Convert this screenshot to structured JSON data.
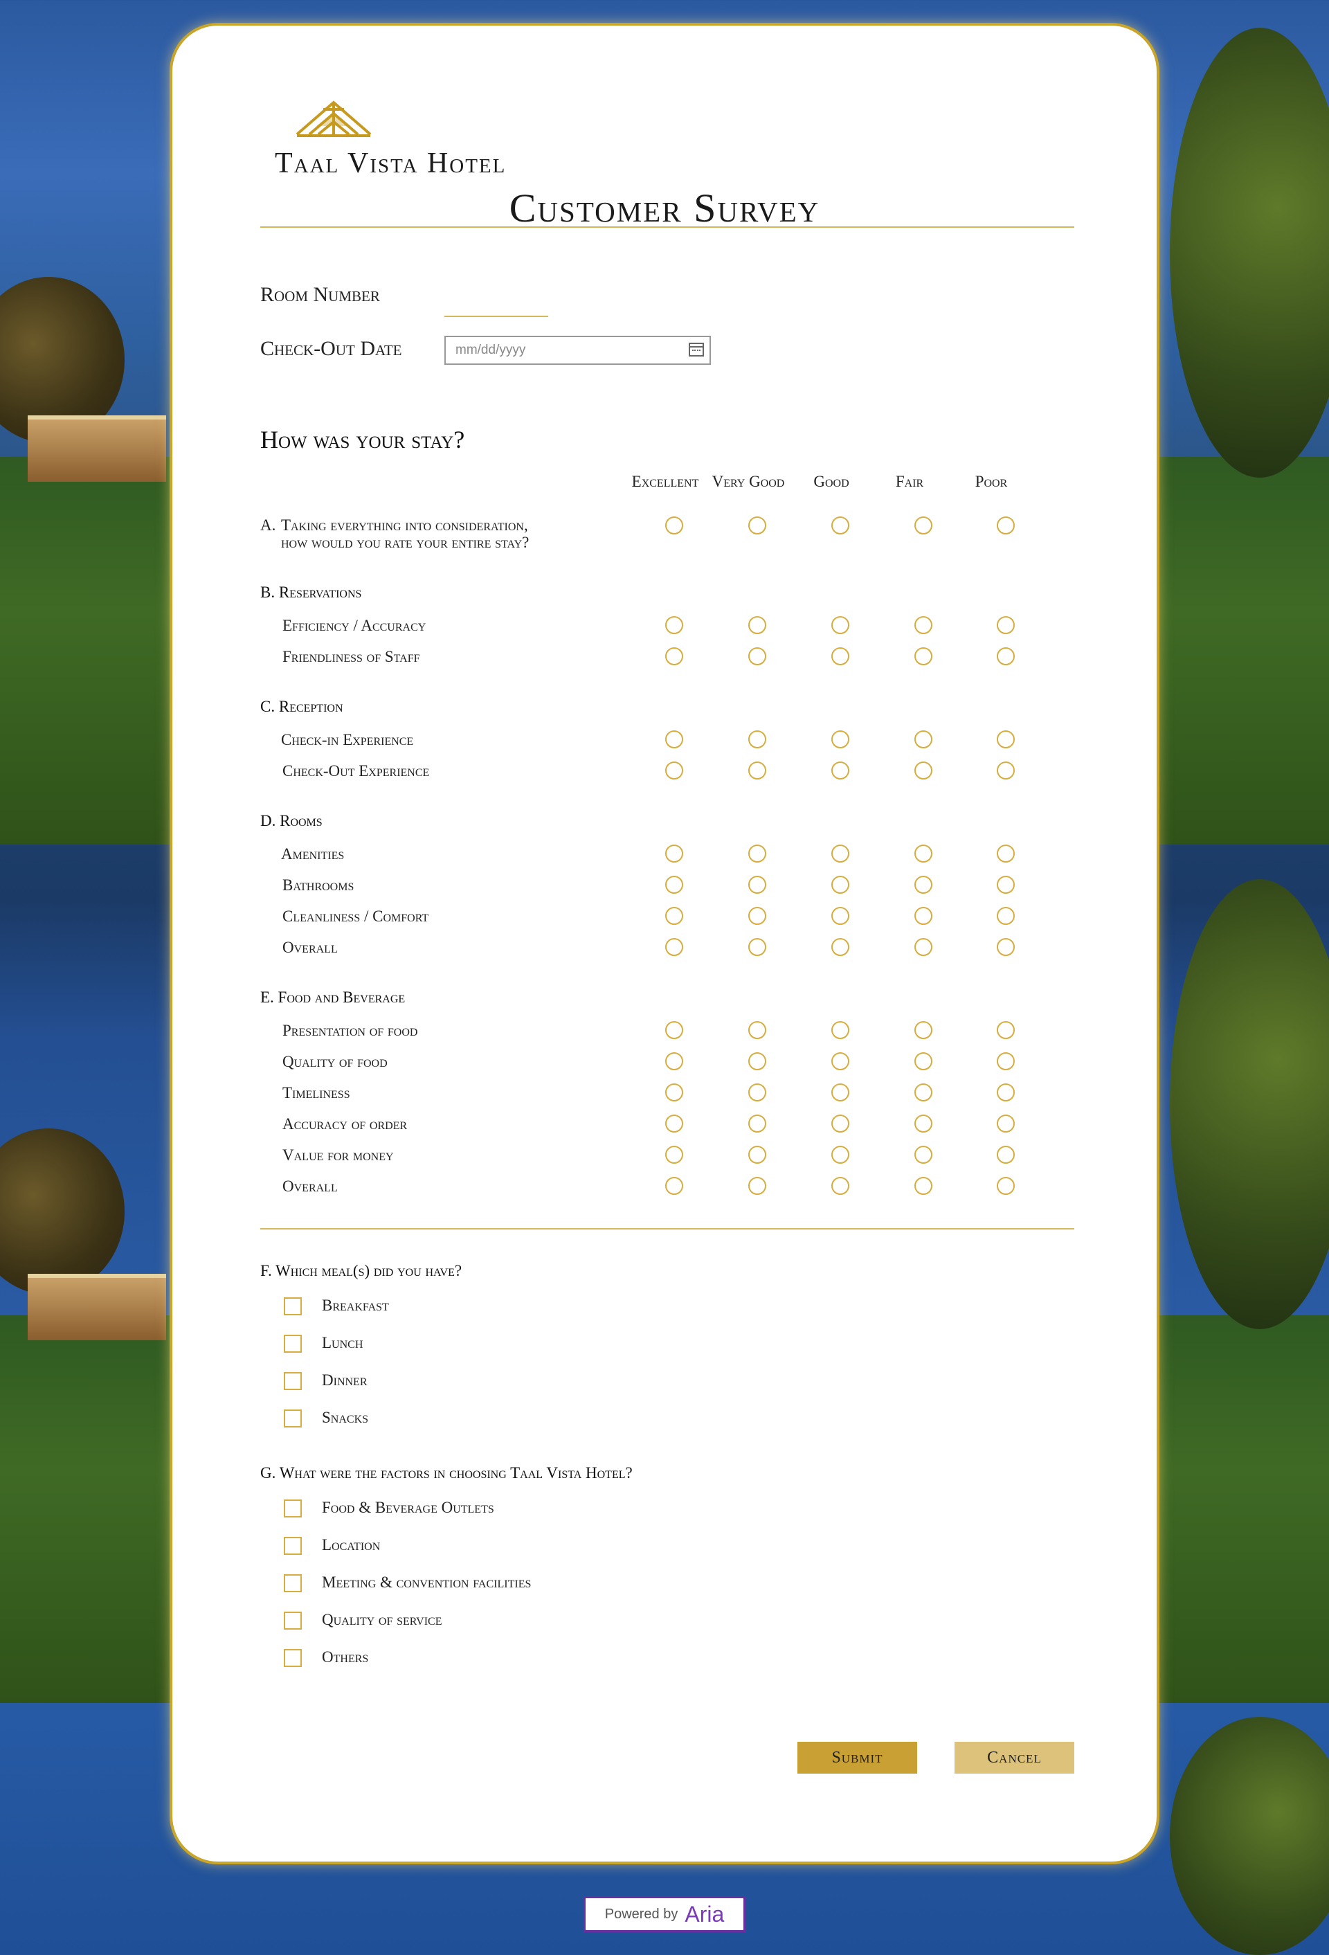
{
  "brand": {
    "name": "Taal Vista Hotel",
    "accent": "#c9a52a"
  },
  "page_title": "Customer Survey",
  "room_number": {
    "label": "Room Number",
    "value": ""
  },
  "checkout_date": {
    "label": "Check-Out Date",
    "placeholder": "mm/dd/yyyy"
  },
  "rating_section": {
    "heading": "How was your stay?",
    "columns": [
      "Excellent",
      "Very Good",
      "Good",
      "Fair",
      "Poor"
    ],
    "question_a": {
      "label": "A.",
      "line1": "Taking everything into consideration,",
      "line2": "how would you rate your entire stay?"
    },
    "groups": [
      {
        "label": "B.  Reservations",
        "items": [
          "Efficiency / Accuracy",
          "Friendliness of Staff"
        ]
      },
      {
        "label": "C.  Reception",
        "items": [
          "Check-in Experience",
          "Check-Out Experience"
        ]
      },
      {
        "label": "D.  Rooms",
        "items": [
          "Amenities",
          "Bathrooms",
          "Cleanliness / Comfort",
          "Overall"
        ]
      },
      {
        "label": "E.  Food and Beverage",
        "items": [
          "Presentation of food",
          "Quality of food",
          "Timeliness",
          "Accuracy of order",
          "Value for money",
          "Overall"
        ]
      }
    ]
  },
  "meals": {
    "question": "F.  Which meal(s) did you have?",
    "options": [
      "Breakfast",
      "Lunch",
      "Dinner",
      "Snacks"
    ]
  },
  "factors": {
    "question": "G.  What were the factors in choosing Taal Vista Hotel?",
    "options": [
      "Food & Beverage Outlets",
      "Location",
      "Meeting & convention facilities",
      "Quality of service",
      "Others"
    ]
  },
  "buttons": {
    "submit": "Submit",
    "cancel": "Cancel"
  },
  "powered_by": {
    "text": "Powered by",
    "brand": "Aria",
    "brand_color": "#7b3bb8"
  }
}
